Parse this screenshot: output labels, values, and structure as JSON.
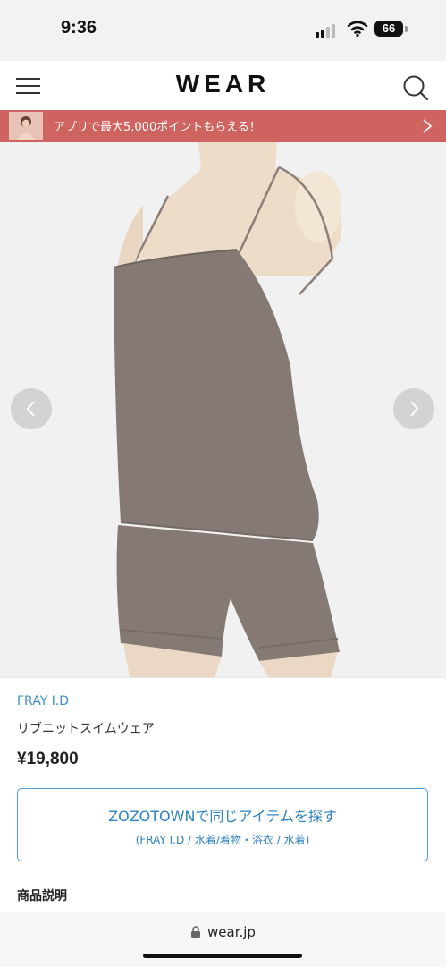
{
  "status_bar": {
    "time": "9:36",
    "battery": "66"
  },
  "header": {
    "logo": "WEAR"
  },
  "promo": {
    "text": "アプリで最大5,000ポイントもらえる！"
  },
  "product": {
    "brand": "FRAY I.D",
    "name": "リブニットスイムウェア",
    "price": "¥19,800"
  },
  "zozo_button": {
    "label": "ZOZOTOWNで同じアイテムを探す",
    "sub_label": "(FRAY I.D / 水着/着物・浴衣 / 水着)"
  },
  "section": {
    "title": "商品説明"
  },
  "address_bar": {
    "url": "wear.jp"
  },
  "colors": {
    "promo_bg": "#cf6360",
    "link_blue": "#3f8fc4",
    "garment": "#857a73"
  },
  "icons": [
    "menu-icon",
    "search-icon",
    "chevron-right-icon",
    "chevron-left-icon",
    "lock-icon",
    "wifi-icon",
    "cellular-signal-icon",
    "battery-icon"
  ]
}
